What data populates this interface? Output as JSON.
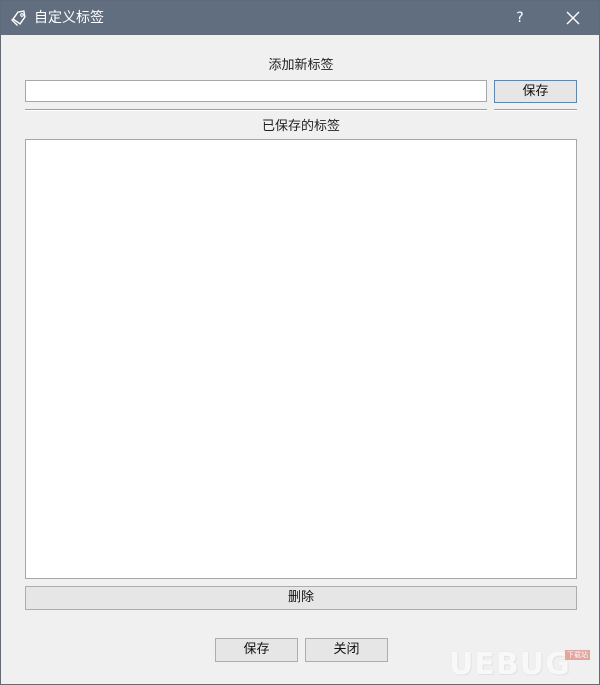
{
  "window": {
    "title": "自定义标签",
    "help_label": "?",
    "colors": {
      "titlebar": "#616e7f",
      "background": "#f0f0f0",
      "focus_border": "#3c8fdc"
    }
  },
  "add_section": {
    "label": "添加新标签",
    "input_value": "",
    "save_label": "保存"
  },
  "saved_section": {
    "label": "已保存的标签",
    "items": []
  },
  "actions": {
    "delete_label": "删除",
    "save_label": "保存",
    "close_label": "关闭"
  },
  "watermark": {
    "text": "UEBUG",
    "sub": "下载站"
  },
  "icons": {
    "title_icon": "tag-icon",
    "close_icon": "close-icon"
  }
}
